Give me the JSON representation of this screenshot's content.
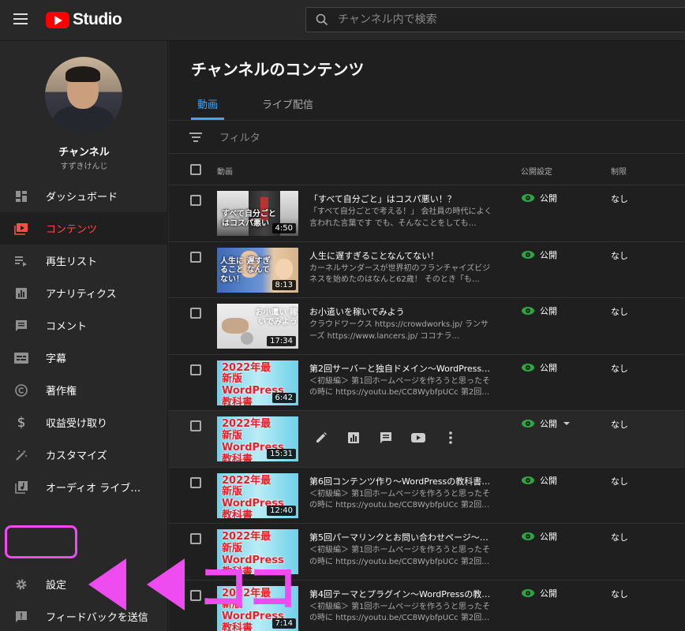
{
  "header": {
    "logo_text": "Studio",
    "search_placeholder": "チャンネル内で検索"
  },
  "sidebar": {
    "channel_name": "チャンネル",
    "channel_handle": "すずきけんじ",
    "items": [
      {
        "label": "ダッシュボード",
        "icon": "dashboard-icon"
      },
      {
        "label": "コンテンツ",
        "icon": "content-icon",
        "active": true
      },
      {
        "label": "再生リスト",
        "icon": "playlist-icon"
      },
      {
        "label": "アナリティクス",
        "icon": "analytics-icon"
      },
      {
        "label": "コメント",
        "icon": "comment-icon"
      },
      {
        "label": "字幕",
        "icon": "subtitles-icon"
      },
      {
        "label": "著作権",
        "icon": "copyright-icon"
      },
      {
        "label": "収益受け取り",
        "icon": "dollar-icon"
      },
      {
        "label": "カスタマイズ",
        "icon": "magic-wand-icon"
      },
      {
        "label": "オーディオ ライブ…",
        "icon": "audio-library-icon"
      }
    ],
    "bottom_items": [
      {
        "label": "設定",
        "icon": "gear-icon"
      },
      {
        "label": "フィードバックを送信",
        "icon": "feedback-icon"
      }
    ]
  },
  "main": {
    "title": "チャンネルのコンテンツ",
    "tabs": [
      {
        "label": "動画",
        "active": true
      },
      {
        "label": "ライブ配信"
      }
    ],
    "filter_label": "フィルタ",
    "columns": {
      "video": "動画",
      "visibility": "公開設定",
      "restrictions": "制限"
    },
    "rows": [
      {
        "title": "「すべて自分ごと」はコスパ悪い！？",
        "desc": "「すべて自分ごとで考える！」 会社員の時代によく言われた言葉です でも、そんなことをしても…",
        "duration": "4:50",
        "visibility": "公開",
        "restriction": "なし",
        "thumb_text": "すべて自分ごと はコスパ悪い"
      },
      {
        "title": "人生に遅すぎることなんてない！",
        "desc": "カーネルサンダースが世界初のフランチャイズビジネスを始めたのはなんと62歳！ そのとき「も…",
        "duration": "8:13",
        "visibility": "公開",
        "restriction": "なし",
        "thumb_text": "人生に 遅すぎること なんてない！"
      },
      {
        "title": "お小遣いを稼いでみよう",
        "desc": "クラウドワークス https://crowdworks.jp/ ランサーズ https://www.lancers.jp/ ココナラ…",
        "duration": "17:34",
        "visibility": "公開",
        "restriction": "なし",
        "thumb_text": "お小遣い 稼いでみよう"
      },
      {
        "title": "第2回サーバーと独自ドメイン〜WordPressの…",
        "desc": "＜初級編＞ 第1回ホームページを作ろうと思ったその時に https://youtu.be/CC8WybfpUCc 第2回…",
        "duration": "6:42",
        "visibility": "公開",
        "restriction": "なし",
        "thumb_text": "2022年最新版 WordPress 教科書"
      },
      {
        "title": "",
        "desc": "",
        "duration": "15:31",
        "visibility": "公開",
        "restriction": "なし",
        "thumb_text": "2022年最新版 WordPress 教科書",
        "hover": true
      },
      {
        "title": "第6回コンテンツ作り〜WordPressの教科書く…",
        "desc": "＜初級編＞ 第1回ホームページを作ろうと思ったその時に https://youtu.be/CC8WybfpUCc 第2回…",
        "duration": "12:40",
        "visibility": "公開",
        "restriction": "なし",
        "thumb_text": "2022年最新版 WordPress 教科書"
      },
      {
        "title": "第5回パーマリンクとお問い合わせページ〜W…",
        "desc": "＜初級編＞ 第1回ホームページを作ろうと思ったその時に https://youtu.be/CC8WybfpUCc 第2回…",
        "duration": "",
        "visibility": "公開",
        "restriction": "なし",
        "thumb_text": "2022年最新版 WordPress 教科書"
      },
      {
        "title": "第4回テーマとプラグイン〜WordPressの教科…",
        "desc": "＜初級編＞ 第1回ホームページを作ろうと思ったその時に https://youtu.be/CC8WybfpUCc 第2回…",
        "duration": "7:14",
        "visibility": "公開",
        "restriction": "なし",
        "thumb_text": "2022年最新版 WordPress 教科書"
      }
    ]
  },
  "annotation": {
    "text": "ココ",
    "color": "#ee4bf0"
  }
}
